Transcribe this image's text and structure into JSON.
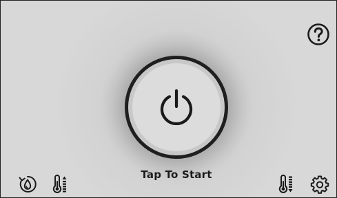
{
  "main": {
    "start_label": "Tap To Start"
  },
  "icons": {
    "help": "help-icon",
    "power": "power-icon",
    "water_cycle": "water-cycle-icon",
    "temp_up": "temperature-up-icon",
    "temp_down": "temperature-down-icon",
    "settings": "gear-icon"
  },
  "colors": {
    "background": "#d8d8d8",
    "button_face": "#dcdcdc",
    "button_ring": "#1f1f1f",
    "icon": "#1a1a1a"
  }
}
